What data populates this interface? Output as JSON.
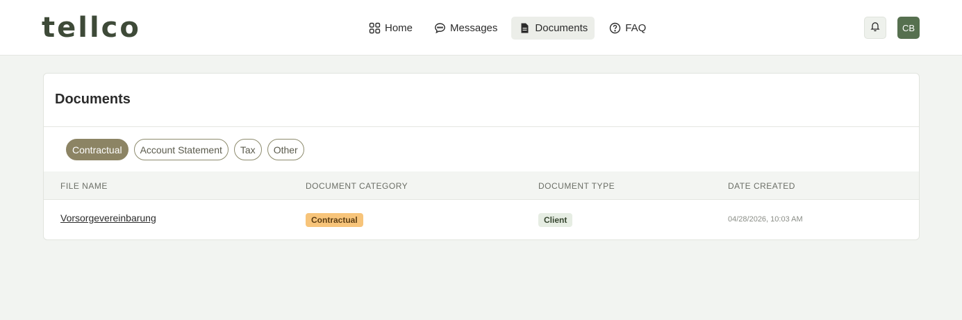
{
  "app": {
    "logo_text": "tellco"
  },
  "nav": {
    "items": [
      {
        "label": "Home",
        "icon": "grid-icon",
        "active": false
      },
      {
        "label": "Messages",
        "icon": "chat-bubble-icon",
        "active": false
      },
      {
        "label": "Documents",
        "icon": "document-icon",
        "active": true
      },
      {
        "label": "FAQ",
        "icon": "help-circle-icon",
        "active": false
      }
    ]
  },
  "header": {
    "notifications_icon": "bell-icon",
    "avatar_initials": "CB"
  },
  "documents": {
    "title": "Documents",
    "filters": [
      {
        "label": "Contractual",
        "active": true
      },
      {
        "label": "Account Statement",
        "active": false
      },
      {
        "label": "Tax",
        "active": false
      },
      {
        "label": "Other",
        "active": false
      }
    ],
    "columns": [
      "FILE NAME",
      "DOCUMENT CATEGORY",
      "DOCUMENT TYPE",
      "DATE CREATED"
    ],
    "rows": [
      {
        "file_name": "Vorsorgevereinbarung",
        "category": "Contractual",
        "type": "Client",
        "date_created": "04/28/2026, 10:03 AM"
      }
    ]
  },
  "colors": {
    "brand": "#3e4a38",
    "avatar": "#56704f",
    "filter_active": "#8c8464",
    "category_badge": "#f7c47a",
    "type_badge": "#e6ede3",
    "page_background": "#f2f4f1"
  }
}
